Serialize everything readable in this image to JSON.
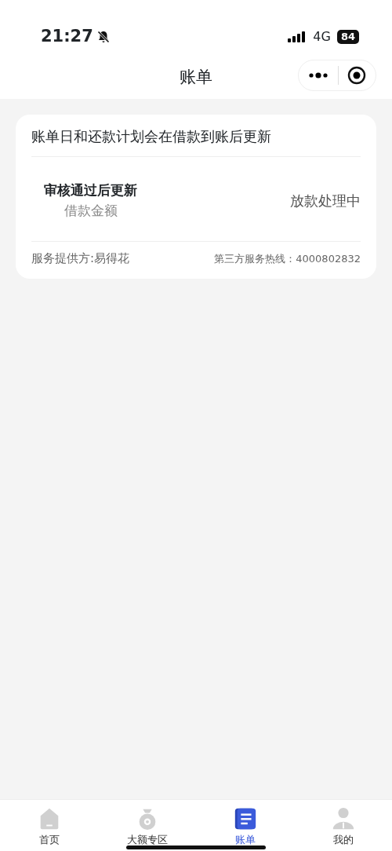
{
  "status_bar": {
    "time": "21:27",
    "network": "4G",
    "battery": "84"
  },
  "nav": {
    "title": "账单"
  },
  "card": {
    "notice": "账单日和还款计划会在借款到账后更新",
    "amount": "审核通过后更新",
    "amount_label": "借款金额",
    "status": "放款处理中",
    "provider": "服务提供方:易得花",
    "hotline": "第三方服务热线：4000802832"
  },
  "tabs": [
    {
      "label": "首页",
      "kind": "home",
      "selected": false
    },
    {
      "label": "大额专区",
      "kind": "bag",
      "selected": false
    },
    {
      "label": "账单",
      "kind": "bill",
      "selected": true
    },
    {
      "label": "我的",
      "kind": "person",
      "selected": false
    }
  ]
}
